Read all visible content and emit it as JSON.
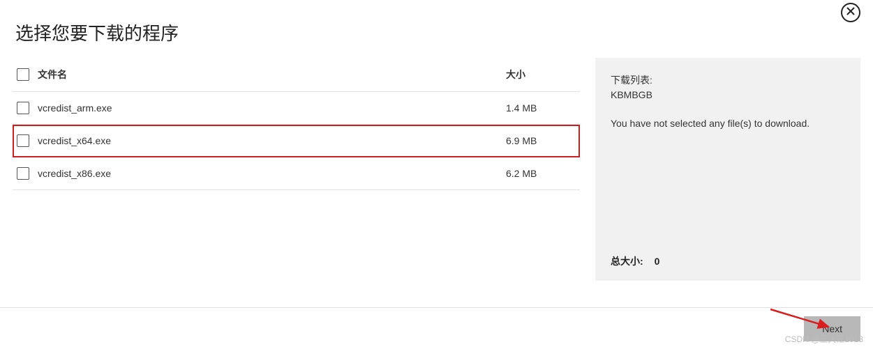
{
  "header": {
    "title": "选择您要下载的程序"
  },
  "table": {
    "col_name": "文件名",
    "col_size": "大小",
    "rows": [
      {
        "name": "vcredist_arm.exe",
        "size": "1.4 MB",
        "highlighted": false
      },
      {
        "name": "vcredist_x64.exe",
        "size": "6.9 MB",
        "highlighted": true
      },
      {
        "name": "vcredist_x86.exe",
        "size": "6.2 MB",
        "highlighted": false
      }
    ]
  },
  "sidebar": {
    "title": "下载列表:",
    "units": "KBMBGB",
    "empty_message": "You have not selected any file(s) to download.",
    "total_label": "总大小:",
    "total_value": "0"
  },
  "footer": {
    "next_label": "Next"
  },
  "watermark": "CSDN @王大江1018"
}
